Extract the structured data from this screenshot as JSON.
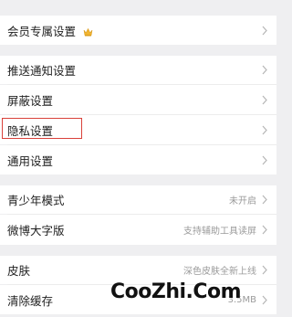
{
  "settings": {
    "groups": [
      [
        {
          "label": "会员专属设置",
          "has_crown": true,
          "value": null
        }
      ],
      [
        {
          "label": "推送通知设置",
          "value": null
        },
        {
          "label": "屏蔽设置",
          "value": null
        },
        {
          "label": "隐私设置",
          "value": null,
          "highlighted": true
        },
        {
          "label": "通用设置",
          "value": null
        }
      ],
      [
        {
          "label": "青少年模式",
          "value": "未开启"
        },
        {
          "label": "微博大字版",
          "value": "支持辅助工具读屏"
        }
      ],
      [
        {
          "label": "皮肤",
          "value": "深色皮肤全新上线"
        },
        {
          "label": "清除缓存",
          "value": "3.5MB"
        }
      ]
    ]
  },
  "watermark": {
    "text": "CooZhi.Com"
  },
  "colors": {
    "background": "#efeff1",
    "row": "#ffffff",
    "highlight_border": "#d9413a",
    "secondary_text": "#9a9a9a"
  },
  "icons": {
    "crown": "crown-icon",
    "chevron": "chevron-right-icon"
  }
}
